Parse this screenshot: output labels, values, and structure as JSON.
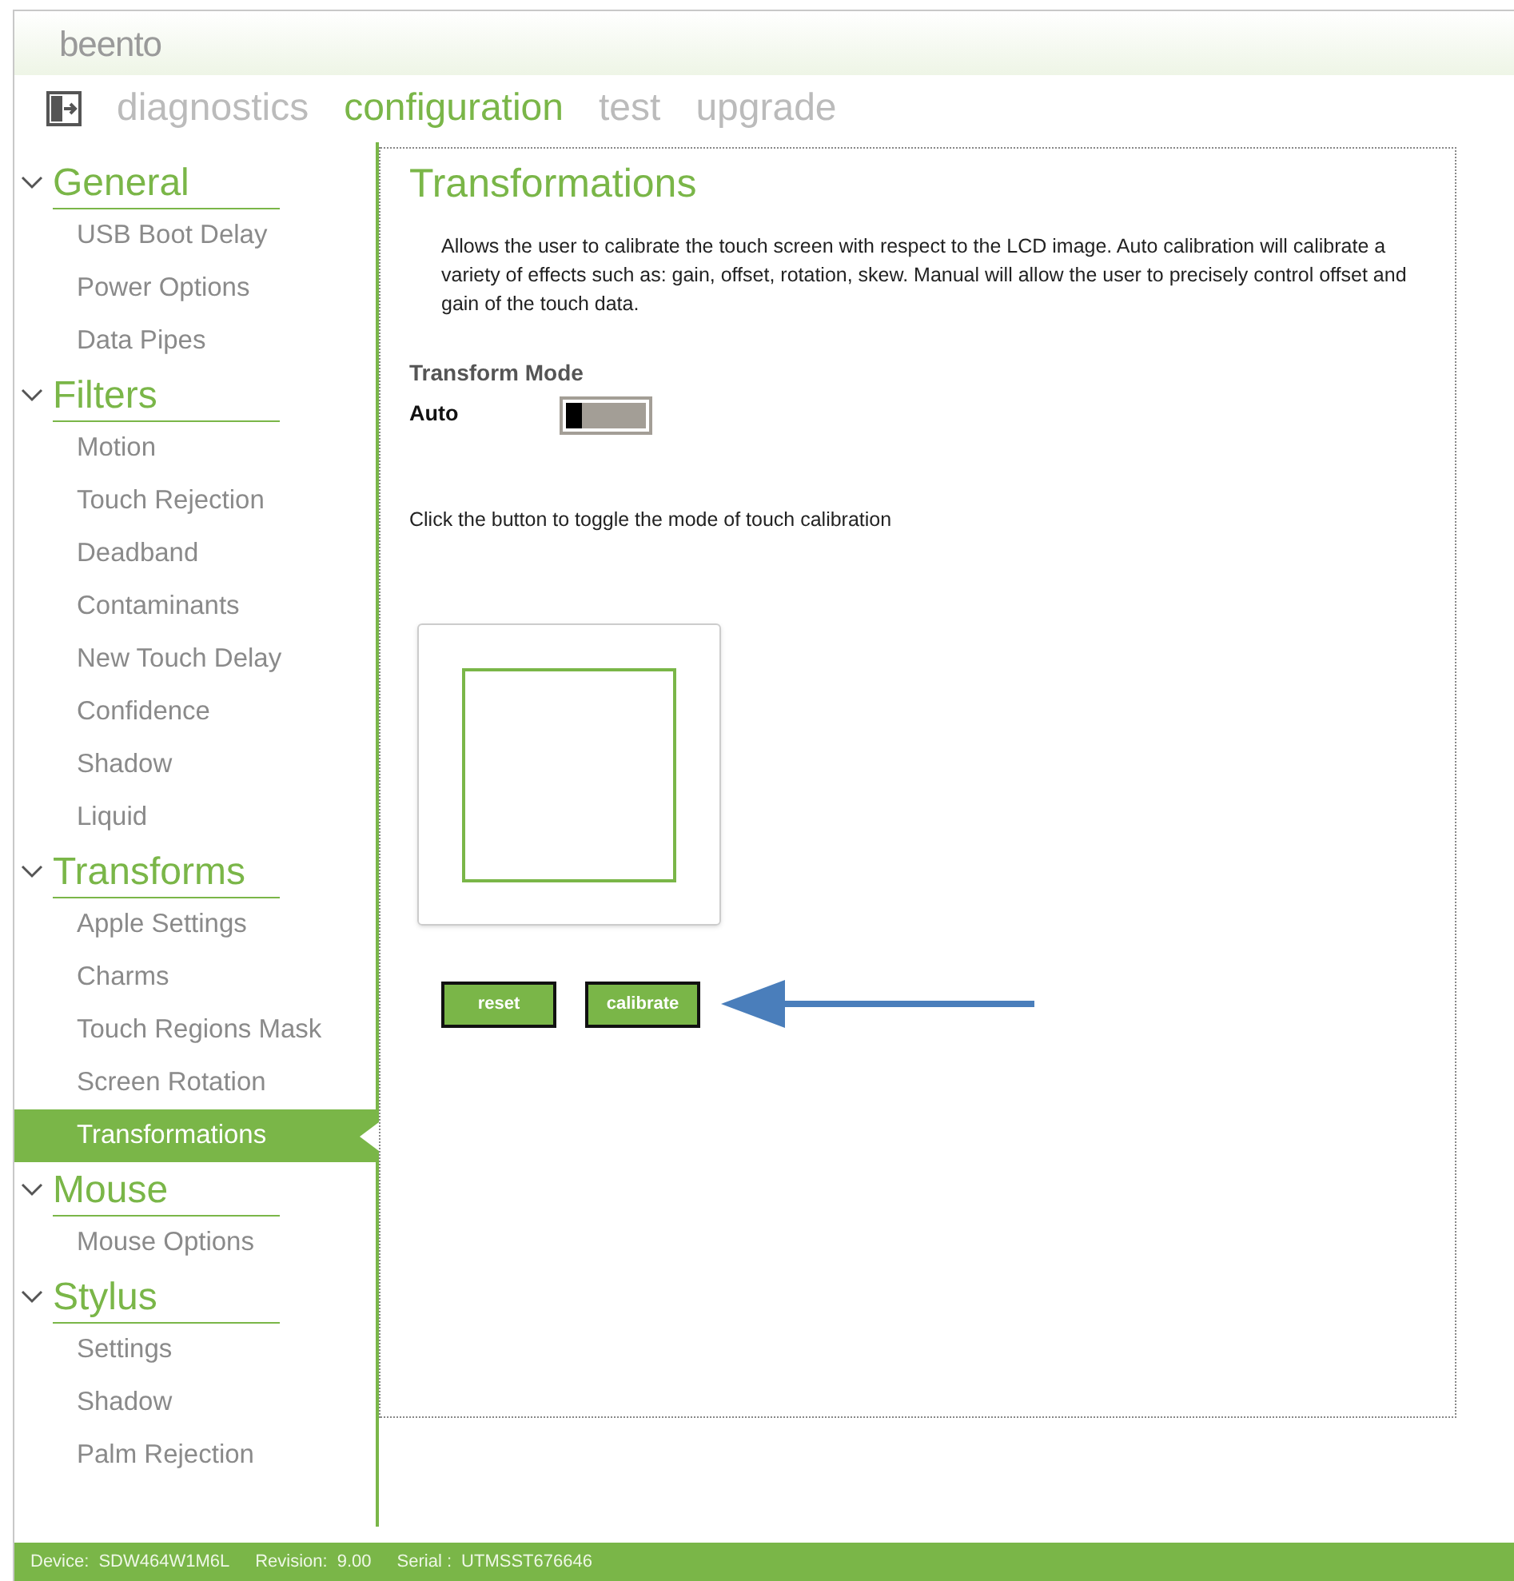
{
  "logo": "beento",
  "nav": [
    {
      "label": "diagnostics",
      "selected": false
    },
    {
      "label": "configuration",
      "selected": true
    },
    {
      "label": "test",
      "selected": false
    },
    {
      "label": "upgrade",
      "selected": false
    }
  ],
  "sidebar": [
    {
      "label": "General",
      "expanded": true,
      "children": [
        {
          "label": "USB Boot Delay",
          "selected": false
        },
        {
          "label": "Power Options",
          "selected": false
        },
        {
          "label": "Data Pipes",
          "selected": false
        }
      ]
    },
    {
      "label": "Filters",
      "expanded": true,
      "children": [
        {
          "label": "Motion",
          "selected": false
        },
        {
          "label": "Touch Rejection",
          "selected": false
        },
        {
          "label": "Deadband",
          "selected": false
        },
        {
          "label": "Contaminants",
          "selected": false
        },
        {
          "label": "New Touch Delay",
          "selected": false
        },
        {
          "label": "Confidence",
          "selected": false
        },
        {
          "label": "Shadow",
          "selected": false
        },
        {
          "label": "Liquid",
          "selected": false
        }
      ]
    },
    {
      "label": "Transforms",
      "expanded": true,
      "children": [
        {
          "label": "Apple Settings",
          "selected": false
        },
        {
          "label": "Charms",
          "selected": false
        },
        {
          "label": "Touch Regions Mask",
          "selected": false
        },
        {
          "label": "Screen Rotation",
          "selected": false
        },
        {
          "label": "Transformations",
          "selected": true
        }
      ]
    },
    {
      "label": "Mouse",
      "expanded": true,
      "children": [
        {
          "label": "Mouse Options",
          "selected": false
        }
      ]
    },
    {
      "label": "Stylus",
      "expanded": true,
      "children": [
        {
          "label": "Settings",
          "selected": false
        },
        {
          "label": "Shadow",
          "selected": false
        },
        {
          "label": "Palm Rejection",
          "selected": false
        }
      ]
    }
  ],
  "panel": {
    "title": "Transformations",
    "description": "Allows the user to calibrate the touch screen with respect to the LCD image. Auto calibration will calibrate a variety of effects such as: gain, offset, rotation, skew. Manual will allow the user to precisely control offset and gain of the touch data.",
    "mode_heading": "Transform Mode",
    "mode_label": "Auto",
    "mode_toggle": {
      "on": false
    },
    "hint": "Click the button to toggle the mode of touch calibration",
    "buttons": [
      "reset",
      "calibrate"
    ]
  },
  "status_bar": [
    {
      "label": "Device:",
      "value": "SDW464W1M6L"
    },
    {
      "label": "Revision:",
      "value": "9.00"
    },
    {
      "label": "Serial :",
      "value": "UTMSST676646"
    }
  ]
}
